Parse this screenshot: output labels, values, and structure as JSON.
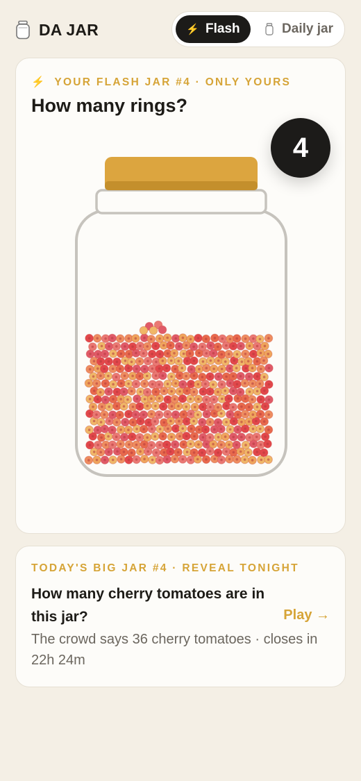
{
  "app": {
    "title": "DA JAR"
  },
  "mode_toggle": {
    "flash_label": "Flash",
    "daily_label": "Daily jar",
    "active": "Flash"
  },
  "flash_card": {
    "eyebrow": "YOUR FLASH JAR #4 · ONLY YOURS",
    "question": "How many rings?",
    "guess_value": "4",
    "item_colors": [
      "#e2474b",
      "#e8694c",
      "#ee8d5f",
      "#efa55c",
      "#f0b768",
      "#e05a68",
      "#ea7873"
    ],
    "lid_color": "#dca53f"
  },
  "daily_card": {
    "eyebrow": "TODAY'S BIG JAR #4 · REVEAL TONIGHT",
    "question": "How many cherry tomatoes are in this jar?",
    "play_label": "Play →",
    "crowd_text": "The crowd says 36 cherry tomatoes · closes in 22h 24m"
  },
  "icons": {
    "logo": "jar-icon",
    "flash": "lightning-bolt-icon",
    "daily": "jar-icon"
  }
}
